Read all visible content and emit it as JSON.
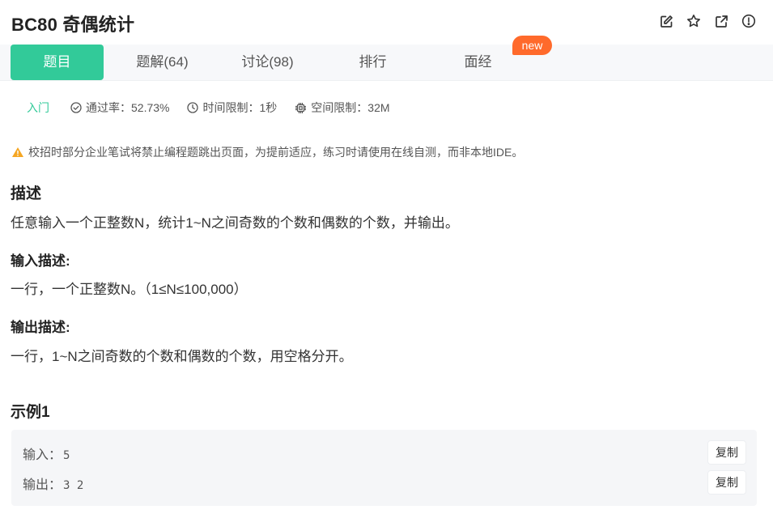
{
  "problem": {
    "title": "BC80  奇偶统计"
  },
  "title_actions": [
    {
      "icon": "edit-icon"
    },
    {
      "icon": "star-icon"
    },
    {
      "icon": "share-icon"
    },
    {
      "icon": "info-icon"
    }
  ],
  "tabs": {
    "problem": "题目",
    "solutions": "题解(64)",
    "discuss": "讨论(98)",
    "ranking": "排行",
    "interview": "面经",
    "new_badge": "new"
  },
  "meta": {
    "level": "入门",
    "pass_rate": "通过率：52.73%",
    "time_limit": "时间限制：1秒",
    "space_limit": "空间限制：32M"
  },
  "warning": "校招时部分企业笔试将禁止编程题跳出页面，为提前适应，练习时请使用在线自测，而非本地IDE。",
  "description": {
    "heading": "描述",
    "text": "任意输入一个正整数N，统计1~N之间奇数的个数和偶数的个数，并输出。"
  },
  "input_desc": {
    "heading": "输入描述:",
    "text": "一行，一个正整数N。（1≤N≤100,000）"
  },
  "output_desc": {
    "heading": "输出描述:",
    "text": "一行，1~N之间奇数的个数和偶数的个数，用空格分开。"
  },
  "example": {
    "heading": "示例1",
    "input_label": "输入：",
    "input_value": "5",
    "output_label": "输出：",
    "output_value": "3 2",
    "copy_label": "复制"
  },
  "colors": {
    "accent": "#32ca99",
    "badge": "#ff6a2b",
    "warning": "#f5a623"
  }
}
